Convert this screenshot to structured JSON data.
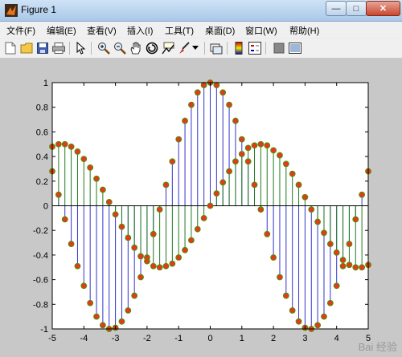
{
  "window": {
    "title": "Figure 1",
    "controls": {
      "minimize": "—",
      "maximize": "□",
      "close": "✕"
    }
  },
  "menu": [
    "文件(F)",
    "编辑(E)",
    "查看(V)",
    "插入(I)",
    "工具(T)",
    "桌面(D)",
    "窗口(W)",
    "帮助(H)"
  ],
  "toolbar": {
    "icons": [
      "new-figure-icon",
      "open-file-icon",
      "save-icon",
      "print-icon",
      "select-arrow-icon",
      "zoom-in-icon",
      "zoom-out-icon",
      "pan-hand-icon",
      "rotate-3d-icon",
      "data-cursor-icon",
      "brush-icon",
      "link-plot-icon",
      "colorbar-icon",
      "legend-icon",
      "hide-plot-tools-icon",
      "show-plot-tools-icon"
    ]
  },
  "watermark": "Bai 经验",
  "colors": {
    "series1": "#3333cc",
    "series2": "#1f7a1f",
    "marker_fill": "#ee3322",
    "marker_edge": "#5b8a00"
  },
  "chart_data": {
    "type": "stem",
    "title": "",
    "xlabel": "",
    "ylabel": "",
    "xlim": [
      -5,
      5
    ],
    "ylim": [
      -1,
      1
    ],
    "xticks": [
      -5,
      -4,
      -3,
      -2,
      -1,
      0,
      1,
      2,
      3,
      4,
      5
    ],
    "yticks": [
      -1,
      -0.8,
      -0.6,
      -0.4,
      -0.2,
      0,
      0.2,
      0.4,
      0.6,
      0.8,
      1
    ],
    "grid": false,
    "series": [
      {
        "x": [
          -5.0,
          -4.8,
          -4.6,
          -4.4,
          -4.2,
          -4.0,
          -3.8,
          -3.6,
          -3.4,
          -3.2,
          -3.0,
          -2.8,
          -2.6,
          -2.4,
          -2.2,
          -2.0,
          -1.8,
          -1.6,
          -1.4,
          -1.2,
          -1.0,
          -0.8,
          -0.6,
          -0.4,
          -0.2,
          0.0,
          0.2,
          0.4,
          0.6,
          0.8,
          1.0,
          1.2,
          1.4,
          1.6,
          1.8,
          2.0,
          2.2,
          2.4,
          2.6,
          2.8,
          3.0,
          3.2,
          3.4,
          3.6,
          3.8,
          4.0,
          4.2,
          4.4,
          4.6,
          4.8,
          5.0
        ],
        "y": [
          0.28,
          0.09,
          -0.11,
          -0.31,
          -0.49,
          -0.65,
          -0.79,
          -0.9,
          -0.97,
          -1.0,
          -0.99,
          -0.94,
          -0.85,
          -0.73,
          -0.58,
          -0.42,
          -0.23,
          -0.03,
          0.17,
          0.36,
          0.54,
          0.69,
          0.82,
          0.92,
          0.98,
          1.0,
          0.98,
          0.92,
          0.82,
          0.69,
          0.54,
          0.36,
          0.17,
          -0.03,
          -0.23,
          -0.42,
          -0.58,
          -0.73,
          -0.85,
          -0.94,
          -0.99,
          -1.0,
          -0.97,
          -0.9,
          -0.79,
          -0.65,
          -0.49,
          -0.31,
          -0.11,
          0.09,
          0.28
        ]
      },
      {
        "x": [
          -5.0,
          -4.8,
          -4.6,
          -4.4,
          -4.2,
          -4.0,
          -3.8,
          -3.6,
          -3.4,
          -3.2,
          -3.0,
          -2.8,
          -2.6,
          -2.4,
          -2.2,
          -2.0,
          -1.8,
          -1.6,
          -1.4,
          -1.2,
          -1.0,
          -0.8,
          -0.6,
          -0.4,
          -0.2,
          0.0,
          0.2,
          0.4,
          0.6,
          0.8,
          1.0,
          1.2,
          1.4,
          1.6,
          1.8,
          2.0,
          2.2,
          2.4,
          2.6,
          2.8,
          3.0,
          3.2,
          3.4,
          3.6,
          3.8,
          4.0,
          4.2,
          4.4,
          4.6,
          4.8,
          5.0
        ],
        "y": [
          0.48,
          0.5,
          0.5,
          0.48,
          0.44,
          0.38,
          0.31,
          0.22,
          0.13,
          0.03,
          -0.07,
          -0.17,
          -0.26,
          -0.34,
          -0.41,
          -0.45,
          -0.49,
          -0.5,
          -0.49,
          -0.47,
          -0.42,
          -0.36,
          -0.28,
          -0.19,
          -0.1,
          0.0,
          0.1,
          0.19,
          0.28,
          0.36,
          0.42,
          0.47,
          0.49,
          0.5,
          0.49,
          0.45,
          0.41,
          0.34,
          0.26,
          0.17,
          0.07,
          -0.03,
          -0.13,
          -0.22,
          -0.31,
          -0.38,
          -0.44,
          -0.48,
          -0.5,
          -0.5,
          -0.48
        ]
      }
    ]
  }
}
